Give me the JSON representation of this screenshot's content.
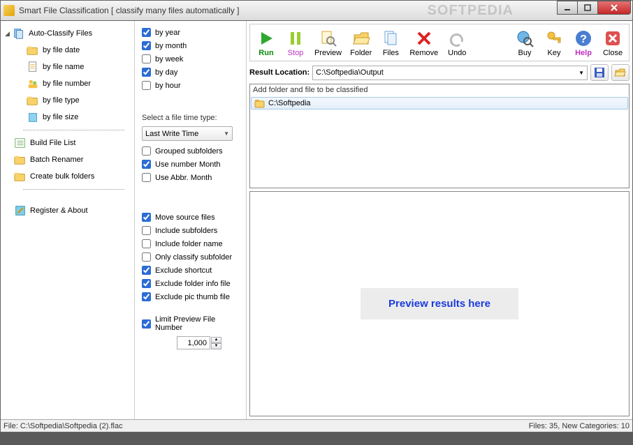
{
  "window": {
    "title": "Smart File Classification [ classify many files automatically ]",
    "watermark": "SOFTPEDIA"
  },
  "tree": {
    "root": "Auto-Classify Files",
    "children": [
      "by file date",
      "by file name",
      "by file number",
      "by file type",
      "by file size"
    ],
    "other": [
      "Build File List",
      "Batch Renamer",
      "Create bulk folders"
    ],
    "register": "Register & About"
  },
  "options": {
    "time_grain": {
      "by_year": "by year",
      "by_month": "by month",
      "by_week": "by week",
      "by_day": "by day",
      "by_hour": "by hour"
    },
    "time_checked": {
      "by_year": true,
      "by_month": true,
      "by_week": false,
      "by_day": true,
      "by_hour": false
    },
    "filetime_label": "Select a file time type:",
    "filetime_value": "Last Write Time",
    "grouped_subfolders": "Grouped subfolders",
    "use_number_month": "Use number Month",
    "use_abbr_month": "Use Abbr. Month",
    "grouped_checked": false,
    "number_month_checked": true,
    "abbr_month_checked": false,
    "move_source": "Move source files",
    "include_subfolders": "Include subfolders",
    "include_folder_name": "Include folder name",
    "only_classify_subfolder": "Only classify subfolder",
    "exclude_shortcut": "Exclude shortcut",
    "exclude_folder_info": "Exclude folder info file",
    "exclude_pic_thumb": "Exclude pic thumb file",
    "section3_checked": {
      "move_source": true,
      "include_subfolders": false,
      "include_folder_name": false,
      "only_classify_subfolder": false,
      "exclude_shortcut": true,
      "exclude_folder_info": true,
      "exclude_pic_thumb": true
    },
    "limit_preview": "Limit Preview File Number",
    "limit_checked": true,
    "limit_value": "1,000"
  },
  "toolbar": {
    "run": "Run",
    "stop": "Stop",
    "preview": "Preview",
    "folder": "Folder",
    "files": "Files",
    "remove": "Remove",
    "undo": "Undo",
    "buy": "Buy",
    "key": "Key",
    "help": "Help",
    "close": "Close"
  },
  "location": {
    "label": "Result Location:",
    "value": "C:\\Softpedia\\Output"
  },
  "list": {
    "header": "Add folder and file to be classified",
    "item": "C:\\Softpedia"
  },
  "preview_text": "Preview results here",
  "status": {
    "left": "File: C:\\Softpedia\\Softpedia (2).flac",
    "right": "Files: 35, New Categories: 10"
  }
}
